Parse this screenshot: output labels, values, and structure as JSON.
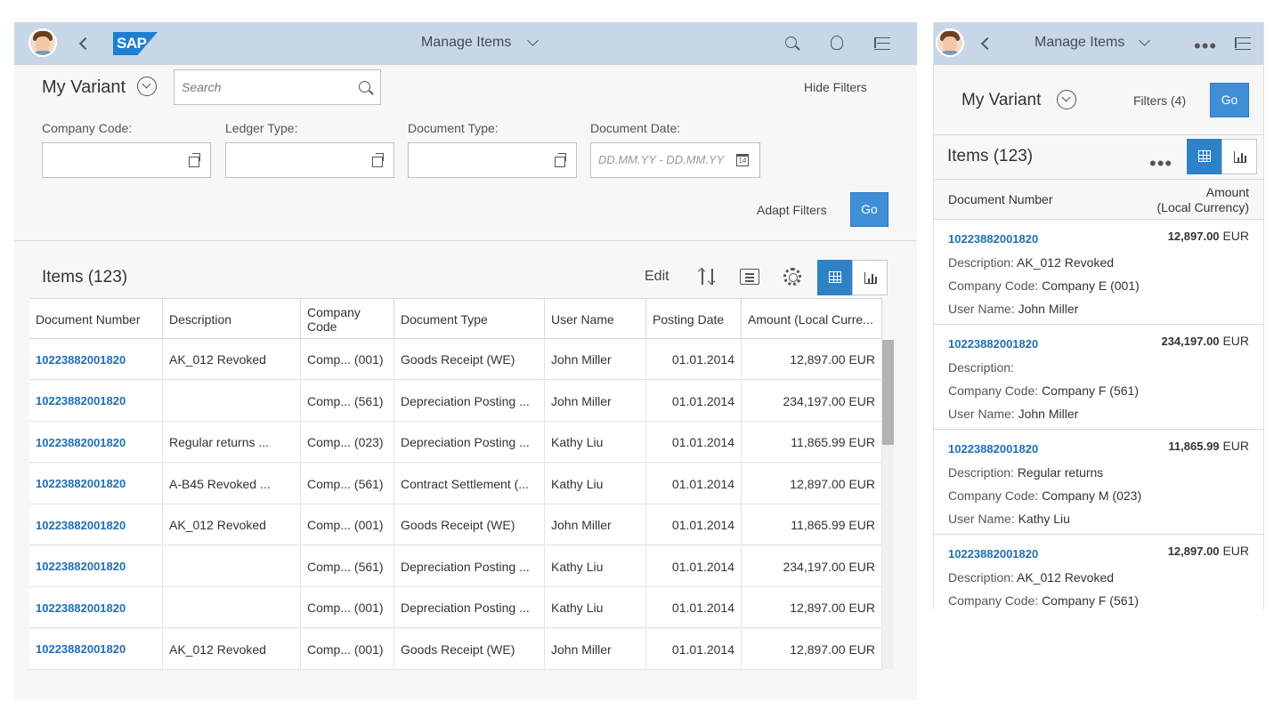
{
  "desktop": {
    "shell": {
      "title": "Manage Items",
      "logo": "SAP",
      "icons": [
        "search-icon",
        "notifications-icon",
        "menu-icon"
      ]
    },
    "filterbar": {
      "variant": "My Variant",
      "search_placeholder": "Search",
      "hide_filters": "Hide Filters",
      "fields": [
        {
          "label": "Company Code:",
          "value": ""
        },
        {
          "label": "Ledger Type:",
          "value": ""
        },
        {
          "label": "Document Type:",
          "value": ""
        },
        {
          "label": "Document Date:",
          "placeholder": "DD.MM.YY - DD.MM.YY"
        }
      ],
      "adapt_filters": "Adapt Filters",
      "go": "Go"
    },
    "table": {
      "title": "Items (123)",
      "edit": "Edit",
      "columns": [
        "Document Number",
        "Description",
        "Company Code",
        "Document Type",
        "User Name",
        "Posting Date",
        "Amount (Local Curre..."
      ],
      "rows": [
        [
          "10223882001820",
          "AK_012 Revoked",
          "Comp... (001)",
          "Goods Receipt (WE)",
          "John Miller",
          "01.01.2014",
          "12,897.00 EUR"
        ],
        [
          "10223882001820",
          "",
          "Comp... (561)",
          "Depreciation Posting ...",
          "John Miller",
          "01.01.2014",
          "234,197.00 EUR"
        ],
        [
          "10223882001820",
          "Regular returns ...",
          "Comp... (023)",
          "Depreciation Posting ...",
          "Kathy Liu",
          "01.01.2014",
          "11,865.99 EUR"
        ],
        [
          "10223882001820",
          "A-B45 Revoked ...",
          "Comp... (561)",
          "Contract Settlement (...",
          "Kathy Liu",
          "01.01.2014",
          "12,897.00 EUR"
        ],
        [
          "10223882001820",
          "AK_012 Revoked",
          "Comp... (001)",
          "Goods Receipt (WE)",
          "John Miller",
          "01.01.2014",
          "11,865.99 EUR"
        ],
        [
          "10223882001820",
          "",
          "Comp... (561)",
          "Depreciation Posting ...",
          "Kathy Liu",
          "01.01.2014",
          "234,197.00 EUR"
        ],
        [
          "10223882001820",
          "",
          "Comp... (001)",
          "Depreciation Posting ...",
          "Kathy Liu",
          "01.01.2014",
          "12,897.00 EUR"
        ],
        [
          "10223882001820",
          "AK_012 Revoked",
          "Comp... (001)",
          "Goods Receipt (WE)",
          "John Miller",
          "01.01.2014",
          "12,897.00 EUR"
        ]
      ]
    }
  },
  "mobile": {
    "shell": {
      "title": "Manage Items"
    },
    "variant": "My Variant",
    "filters": "Filters (4)",
    "go": "Go",
    "items_title": "Items (123)",
    "col_doc": "Document Number",
    "col_amount_1": "Amount",
    "col_amount_2": "(Local Currency)",
    "labels": {
      "description": "Description:",
      "company": "Company Code:",
      "user": "User Name:"
    },
    "items": [
      {
        "doc": "10223882001820",
        "amount": "12,897.00",
        "currency": "EUR",
        "description": "AK_012 Revoked",
        "company": "Company E (001)",
        "user": "John Miller"
      },
      {
        "doc": "10223882001820",
        "amount": "234,197.00",
        "currency": "EUR",
        "description": "",
        "company": "Company F (561)",
        "user": "John Miller"
      },
      {
        "doc": "10223882001820",
        "amount": "11,865.99",
        "currency": "EUR",
        "description": "Regular returns",
        "company": "Company M (023)",
        "user": "Kathy Liu"
      },
      {
        "doc": "10223882001820",
        "amount": "12,897.00",
        "currency": "EUR",
        "description": "AK_012 Revoked",
        "company": "Company F (561)",
        "user": ""
      }
    ]
  }
}
